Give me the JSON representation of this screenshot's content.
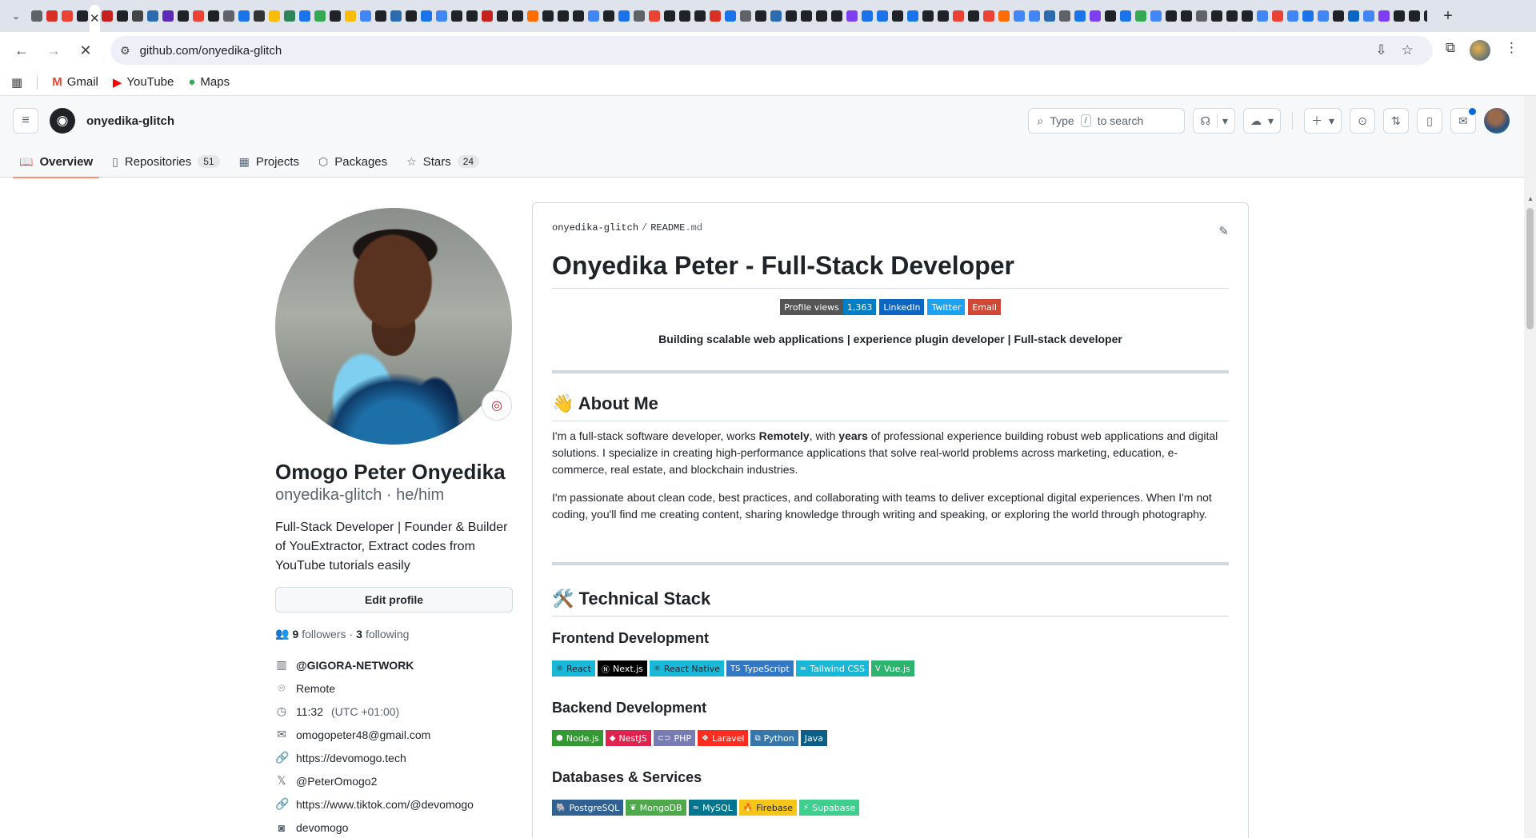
{
  "browser": {
    "tab_favicon_colors": [
      "#5f6368",
      "#d93025",
      "#ea4335",
      "#1f2328",
      "#c5221f",
      "#202124",
      "#444",
      "#2b6cb0",
      "#5b2bb7",
      "#1f2328",
      "#ea4335",
      "#202124",
      "#5f6368",
      "#1a73e8",
      "#333",
      "#fbbc04",
      "#2f855a",
      "#1a73e8",
      "#34a853",
      "#1f2328",
      "#fbbc04",
      "#4285f4",
      "#1f2328",
      "#2b6cb0",
      "#202124",
      "#1a73e8",
      "#4285f4",
      "#1f2328",
      "#1f2328",
      "#c5221f",
      "#1f2328",
      "#1f2328",
      "#ff6d00",
      "#1f2328",
      "#202124",
      "#1f2328",
      "#4285f4",
      "#1f2328",
      "#1a73e8",
      "#5f6368",
      "#ea4335",
      "#1f2328",
      "#1f2328",
      "#1f2328",
      "#d93025",
      "#1a73e8",
      "#5f6368",
      "#1f2328",
      "#2b6cb0",
      "#1f2328",
      "#1f2328",
      "#1f2328",
      "#1f2328",
      "#7e3ff2",
      "#1a73e8",
      "#1a73e8",
      "#1f2328",
      "#1a73e8",
      "#1f2328",
      "#1f2328",
      "#ea4335",
      "#1f2328",
      "#ea4335",
      "#ff6d00",
      "#4285f4",
      "#4285f4",
      "#2b6cb0",
      "#5f6368",
      "#1a73e8",
      "#7e3ff2",
      "#1f2328",
      "#1a73e8",
      "#34a853",
      "#4285f4",
      "#1f2328",
      "#1f2328",
      "#5f6368",
      "#1f2328",
      "#1f2328",
      "#1f2328",
      "#4285f4",
      "#ea4335",
      "#4285f4",
      "#1a73e8",
      "#4285f4",
      "#1f2328",
      "#0a66c2",
      "#4285f4",
      "#7e3ff2",
      "#1f2328",
      "#1f2328",
      "#1f2328",
      "#5f6368",
      "#1f2328",
      "#1a73e8",
      "#1a73e8",
      "#1f2328",
      "#4285f4",
      "#4285f4",
      "#5f6368",
      "#5f6368",
      "#5f6368",
      "#4285f4"
    ],
    "active_tab_close": "✕",
    "new_tab": "+",
    "url": "github.com/onyedika-glitch",
    "bookmarks": [
      {
        "label": "Gmail",
        "color": "#ea4335",
        "icon": "M"
      },
      {
        "label": "YouTube",
        "color": "#ff0000",
        "icon": "▶"
      },
      {
        "label": "Maps",
        "color": "#34a853",
        "icon": "●"
      }
    ]
  },
  "github": {
    "username": "onyedika-glitch",
    "search_placeholder_a": "Type",
    "search_key": "/",
    "search_placeholder_b": "to search",
    "tabs": [
      {
        "label": "Overview",
        "icon": "book-icon",
        "glyph": "📖",
        "count": null
      },
      {
        "label": "Repositories",
        "icon": "repo-icon",
        "glyph": "▯",
        "count": "51"
      },
      {
        "label": "Projects",
        "icon": "table-icon",
        "glyph": "▦",
        "count": null
      },
      {
        "label": "Packages",
        "icon": "package-icon",
        "glyph": "⬡",
        "count": null
      },
      {
        "label": "Stars",
        "icon": "star-icon",
        "glyph": "☆",
        "count": "24"
      }
    ],
    "accent_tab_underline": "#fd8c73"
  },
  "profile": {
    "full_name": "Omogo Peter Onyedika",
    "login_line": "onyedika-glitch · he/him",
    "bio": "Full-Stack Developer | Founder & Builder of YouExtractor, Extract codes from YouTube tutorials easily",
    "edit_button": "Edit profile",
    "followers_count": "9",
    "followers_label": "followers",
    "dot": "·",
    "following_count": "3",
    "following_label": "following",
    "details": [
      {
        "name": "org",
        "icon": "organization-icon",
        "glyph": "▥",
        "text": "@GIGORA-NETWORK"
      },
      {
        "name": "location",
        "icon": "location-icon",
        "glyph": "⌾",
        "text": "Remote"
      },
      {
        "name": "time",
        "icon": "clock-icon",
        "glyph": "◷",
        "text": "11:32",
        "extra": "(UTC +01:00)"
      },
      {
        "name": "email",
        "icon": "mail-icon",
        "glyph": "✉",
        "text": "omogopeter48@gmail.com"
      },
      {
        "name": "website",
        "icon": "link-icon",
        "glyph": "🔗",
        "text": "https://devomogo.tech"
      },
      {
        "name": "x",
        "icon": "x-icon",
        "glyph": "𝕏",
        "text": "@PeterOmogo2"
      },
      {
        "name": "tiktok",
        "icon": "link-icon",
        "glyph": "🔗",
        "text": "https://www.tiktok.com/@devomogo"
      },
      {
        "name": "instagram",
        "icon": "instagram-icon",
        "glyph": "◙",
        "text": "devomogo"
      }
    ]
  },
  "readme": {
    "path_user": "onyedika-glitch",
    "path_sep": "/",
    "path_file": "README",
    "path_ext": ".md",
    "title": "Onyedika Peter - Full-Stack Developer",
    "badges": [
      {
        "left": "Profile views",
        "right": "1,363",
        "left_color": "#555",
        "right_color": "#007ec6"
      },
      {
        "left": "LinkedIn",
        "right": "",
        "left_color": "#0a66c2",
        "right_color": ""
      },
      {
        "left": "Twitter",
        "right": "",
        "left_color": "#1da1f2",
        "right_color": ""
      },
      {
        "left": "Email",
        "right": "",
        "left_color": "#d14836",
        "right_color": ""
      }
    ],
    "tagline": "Building scalable web applications | experience plugin developer | Full-stack developer",
    "about_heading": "About Me",
    "about_emoji": "👋",
    "about_p1_a": "I'm a full-stack software developer, works ",
    "about_p1_b": "Remotely",
    "about_p1_c": ", with ",
    "about_p1_d": "years",
    "about_p1_e": " of professional experience building robust web applications and digital solutions. I specialize in creating high-performance applications that solve real-world problems across marketing, education, e-commerce, real estate, and blockchain industries.",
    "about_p2": "I'm passionate about clean code, best practices, and collaborating with teams to deliver exceptional digital experiences. When I'm not coding, you'll find me creating content, sharing knowledge through writing and speaking, or exploring the world through photography.",
    "stack_heading": "Technical Stack",
    "stack_emoji": "🛠️",
    "frontend_heading": "Frontend Development",
    "frontend": [
      {
        "label": "React",
        "color": "#20232a",
        "bg": "#1ab8d8",
        "icon": "⚛"
      },
      {
        "label": "Next.js",
        "color": "#fff",
        "bg": "#000000",
        "icon": "Ⓝ"
      },
      {
        "label": "React Native",
        "color": "#20232a",
        "bg": "#1ab8d8",
        "icon": "⚛"
      },
      {
        "label": "TypeScript",
        "color": "#fff",
        "bg": "#3178c6",
        "icon": "TS"
      },
      {
        "label": "Tailwind CSS",
        "color": "#fff",
        "bg": "#1ab8d8",
        "icon": "≈"
      },
      {
        "label": "Vue.js",
        "color": "#fff",
        "bg": "#2ab46e",
        "icon": "V"
      }
    ],
    "backend_heading": "Backend Development",
    "backend": [
      {
        "label": "Node.js",
        "color": "#fff",
        "bg": "#339933",
        "icon": "⬢"
      },
      {
        "label": "NestJS",
        "color": "#fff",
        "bg": "#e0234e",
        "icon": "◆"
      },
      {
        "label": "PHP",
        "color": "#fff",
        "bg": "#777bb4",
        "icon": "⊂⊃"
      },
      {
        "label": "Laravel",
        "color": "#fff",
        "bg": "#ff2d20",
        "icon": "❖"
      },
      {
        "label": "Python",
        "color": "#fff",
        "bg": "#3776ab",
        "icon": "⧉"
      },
      {
        "label": "Java",
        "color": "#fff",
        "bg": "#0b5f88",
        "icon": ""
      }
    ],
    "db_heading": "Databases & Services",
    "databases": [
      {
        "label": "PostgreSQL",
        "color": "#fff",
        "bg": "#316192",
        "icon": "🐘"
      },
      {
        "label": "MongoDB",
        "color": "#fff",
        "bg": "#4ea94b",
        "icon": "❦"
      },
      {
        "label": "MySQL",
        "color": "#fff",
        "bg": "#00758f",
        "icon": "≈"
      },
      {
        "label": "Firebase",
        "color": "#1f2328",
        "bg": "#f5c518",
        "icon": "🔥"
      },
      {
        "label": "Supabase",
        "color": "#fff",
        "bg": "#3ecf8e",
        "icon": "⚡"
      }
    ]
  }
}
